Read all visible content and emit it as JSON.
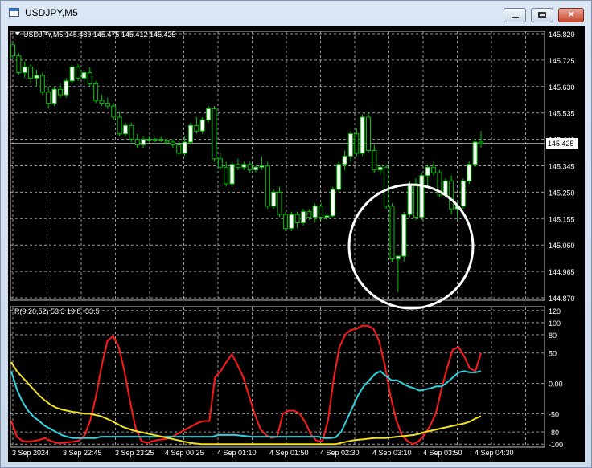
{
  "window": {
    "title": "USDJPY,M5",
    "min_label": "",
    "max_label": "",
    "close_label": "×"
  },
  "chart_data": [
    {
      "type": "candlestick",
      "title": "USDJPY,M5  145.439 145.475 145.412 145.425",
      "symbol": "USDJPY,M5",
      "last_ohlc": [
        145.439,
        145.475,
        145.412,
        145.425
      ],
      "price_ticks": [
        "145.820",
        "145.725",
        "145.630",
        "145.535",
        "145.440",
        "145.345",
        "145.250",
        "145.155",
        "145.060",
        "144.965",
        "144.870"
      ],
      "ylim": [
        144.87,
        145.82
      ],
      "current_price": 145.425,
      "current_price_label": "145.425",
      "up_color": "#ffffff",
      "down_color": "#000000",
      "wick_color": "#00c800",
      "grid": true,
      "annotation": "circle",
      "candles": [
        [
          145.78,
          145.79,
          145.73,
          145.74
        ],
        [
          145.74,
          145.75,
          145.67,
          145.68
        ],
        [
          145.68,
          145.72,
          145.66,
          145.7
        ],
        [
          145.7,
          145.71,
          145.64,
          145.66
        ],
        [
          145.66,
          145.69,
          145.63,
          145.67
        ],
        [
          145.67,
          145.68,
          145.6,
          145.61
        ],
        [
          145.61,
          145.63,
          145.55,
          145.57
        ],
        [
          145.57,
          145.63,
          145.56,
          145.62
        ],
        [
          145.62,
          145.64,
          145.59,
          145.6
        ],
        [
          145.6,
          145.66,
          145.59,
          145.65
        ],
        [
          145.65,
          145.71,
          145.64,
          145.7
        ],
        [
          145.7,
          145.71,
          145.65,
          145.66
        ],
        [
          145.66,
          145.69,
          145.64,
          145.68
        ],
        [
          145.68,
          145.7,
          145.63,
          145.64
        ],
        [
          145.64,
          145.65,
          145.57,
          145.58
        ],
        [
          145.58,
          145.6,
          145.56,
          145.57
        ],
        [
          145.57,
          145.59,
          145.55,
          145.56
        ],
        [
          145.56,
          145.57,
          145.51,
          145.52
        ],
        [
          145.52,
          145.54,
          145.45,
          145.46
        ],
        [
          145.46,
          145.5,
          145.45,
          145.49
        ],
        [
          145.49,
          145.5,
          145.43,
          145.44
        ],
        [
          145.44,
          145.46,
          145.41,
          145.42
        ],
        [
          145.42,
          145.45,
          145.41,
          145.44
        ],
        [
          145.44,
          145.45,
          145.43,
          145.435
        ],
        [
          145.435,
          145.445,
          145.43,
          145.44
        ],
        [
          145.44,
          145.45,
          145.43,
          145.435
        ],
        [
          145.435,
          145.44,
          145.42,
          145.43
        ],
        [
          145.43,
          145.44,
          145.41,
          145.42
        ],
        [
          145.42,
          145.44,
          145.38,
          145.39
        ],
        [
          145.39,
          145.45,
          145.38,
          145.43
        ],
        [
          145.43,
          145.5,
          145.42,
          145.49
        ],
        [
          145.49,
          145.52,
          145.46,
          145.47
        ],
        [
          145.47,
          145.52,
          145.46,
          145.51
        ],
        [
          145.51,
          145.56,
          145.5,
          145.55
        ],
        [
          145.55,
          145.56,
          145.36,
          145.37
        ],
        [
          145.37,
          145.39,
          145.33,
          145.34
        ],
        [
          145.34,
          145.36,
          145.27,
          145.28
        ],
        [
          145.28,
          145.36,
          145.27,
          145.35
        ],
        [
          145.35,
          145.37,
          145.33,
          145.34
        ],
        [
          145.34,
          145.36,
          145.33,
          145.35
        ],
        [
          145.35,
          145.36,
          145.32,
          145.33
        ],
        [
          145.33,
          145.35,
          145.32,
          145.34
        ],
        [
          145.34,
          145.38,
          145.33,
          145.345
        ],
        [
          145.345,
          145.36,
          145.19,
          145.2
        ],
        [
          145.2,
          145.26,
          145.19,
          145.25
        ],
        [
          145.25,
          145.27,
          145.16,
          145.17
        ],
        [
          145.17,
          145.18,
          145.11,
          145.12
        ],
        [
          145.12,
          145.18,
          145.11,
          145.17
        ],
        [
          145.17,
          145.18,
          145.12,
          145.14
        ],
        [
          145.14,
          145.19,
          145.13,
          145.18
        ],
        [
          145.18,
          145.19,
          145.15,
          145.16
        ],
        [
          145.16,
          145.21,
          145.14,
          145.2
        ],
        [
          145.2,
          145.21,
          145.15,
          145.16
        ],
        [
          145.16,
          145.17,
          145.15,
          145.165
        ],
        [
          145.165,
          145.27,
          145.16,
          145.26
        ],
        [
          145.26,
          145.36,
          145.25,
          145.35
        ],
        [
          145.35,
          145.4,
          145.33,
          145.38
        ],
        [
          145.38,
          145.47,
          145.36,
          145.46
        ],
        [
          145.46,
          145.48,
          145.38,
          145.39
        ],
        [
          145.39,
          145.53,
          145.38,
          145.52
        ],
        [
          145.52,
          145.54,
          145.39,
          145.4
        ],
        [
          145.4,
          145.42,
          145.32,
          145.33
        ],
        [
          145.33,
          145.35,
          145.31,
          145.34
        ],
        [
          145.34,
          145.35,
          145.19,
          145.2
        ],
        [
          145.2,
          145.21,
          145.0,
          145.01
        ],
        [
          145.01,
          145.02,
          144.89,
          145.02
        ],
        [
          145.02,
          145.18,
          145.0,
          145.17
        ],
        [
          145.17,
          145.29,
          145.16,
          145.28
        ],
        [
          145.28,
          145.3,
          145.15,
          145.16
        ],
        [
          145.16,
          145.32,
          145.15,
          145.31
        ],
        [
          145.31,
          145.35,
          145.27,
          145.34
        ],
        [
          145.34,
          145.36,
          145.31,
          145.32
        ],
        [
          145.32,
          145.33,
          145.23,
          145.24
        ],
        [
          145.24,
          145.3,
          145.23,
          145.29
        ],
        [
          145.29,
          145.31,
          145.17,
          145.19
        ],
        [
          145.19,
          145.22,
          145.15,
          145.2
        ],
        [
          145.2,
          145.3,
          145.19,
          145.29
        ],
        [
          145.29,
          145.36,
          145.28,
          145.35
        ],
        [
          145.35,
          145.44,
          145.34,
          145.43
        ],
        [
          145.43,
          145.47,
          145.41,
          145.425
        ]
      ]
    },
    {
      "type": "line",
      "title": "R(9,26,52) 53.3 19.8 -53.5",
      "y_ticks": [
        "120",
        "100",
        "80",
        "50",
        "0.00",
        "-50",
        "-80",
        "-100"
      ],
      "y_tick_values": [
        120,
        100,
        80,
        50,
        0,
        -50,
        -80,
        -100
      ],
      "ylim": [
        -105,
        125
      ],
      "grid": true,
      "x_ticks": [
        "3 Sep 2024",
        "3 Sep 22:45",
        "3 Sep 23:25",
        "4 Sep 00:25",
        "4 Sep 01:10",
        "4 Sep 01:50",
        "4 Sep 02:30",
        "4 Sep 03:10",
        "4 Sep 03:50",
        "4 Sep 04:30"
      ],
      "series": [
        {
          "color": "#ff1a1a",
          "values": [
            -62,
            -88,
            -95,
            -96,
            -95,
            -93,
            -90,
            -95,
            -98,
            -98,
            -97,
            -96,
            -94,
            -85,
            -60,
            -20,
            30,
            70,
            78,
            60,
            20,
            -30,
            -75,
            -95,
            -98,
            -95,
            -93,
            -92,
            -90,
            -85,
            -80,
            -75,
            -70,
            -65,
            -62,
            -62,
            10,
            20,
            35,
            48,
            30,
            10,
            -20,
            -50,
            -75,
            -85,
            -90,
            -88,
            -50,
            -45,
            -45,
            -50,
            -65,
            -85,
            -95,
            -95,
            -60,
            10,
            60,
            80,
            88,
            90,
            95,
            95,
            90,
            70,
            30,
            -20,
            -60,
            -85,
            -95,
            -100,
            -95,
            -85,
            -70,
            -50,
            -10,
            25,
            55,
            60,
            45,
            25,
            20,
            50
          ]
        },
        {
          "color": "#2ed3e0",
          "values": [
            20,
            -10,
            -30,
            -45,
            -55,
            -62,
            -70,
            -75,
            -80,
            -85,
            -88,
            -90,
            -90,
            -90,
            -90,
            -90,
            -88,
            -88,
            -88,
            -88,
            -88,
            -88,
            -88,
            -88,
            -88,
            -88,
            -88,
            -88,
            -88,
            -88,
            -88,
            -88,
            -88,
            -88,
            -88,
            -88,
            -88,
            -85,
            -85,
            -85,
            -85,
            -86,
            -87,
            -88,
            -88,
            -88,
            -88,
            -88,
            -88,
            -88,
            -88,
            -88,
            -88,
            -88,
            -88,
            -88,
            -90,
            -90,
            -89,
            -80,
            -60,
            -40,
            -20,
            -5,
            5,
            15,
            20,
            12,
            5,
            5,
            0,
            -5,
            -8,
            -12,
            -10,
            -8,
            -5,
            -5,
            2,
            10,
            18,
            20,
            18,
            18,
            20
          ]
        },
        {
          "color": "#f0e020",
          "values": [
            35,
            20,
            10,
            0,
            -10,
            -20,
            -28,
            -35,
            -40,
            -43,
            -45,
            -47,
            -48,
            -50,
            -50,
            -52,
            -54,
            -58,
            -62,
            -67,
            -72,
            -75,
            -78,
            -80,
            -82,
            -84,
            -86,
            -88,
            -90,
            -92,
            -94,
            -96,
            -98,
            -99,
            -100,
            -100,
            -100,
            -100,
            -100,
            -100,
            -100,
            -100,
            -100,
            -100,
            -100,
            -100,
            -100,
            -100,
            -100,
            -100,
            -100,
            -100,
            -100,
            -100,
            -100,
            -100,
            -100,
            -100,
            -100,
            -98,
            -96,
            -94,
            -93,
            -92,
            -91,
            -90,
            -90,
            -90,
            -89,
            -88,
            -87,
            -86,
            -85,
            -83,
            -80,
            -78,
            -76,
            -74,
            -72,
            -70,
            -68,
            -66,
            -63,
            -58,
            -54
          ]
        }
      ]
    }
  ]
}
